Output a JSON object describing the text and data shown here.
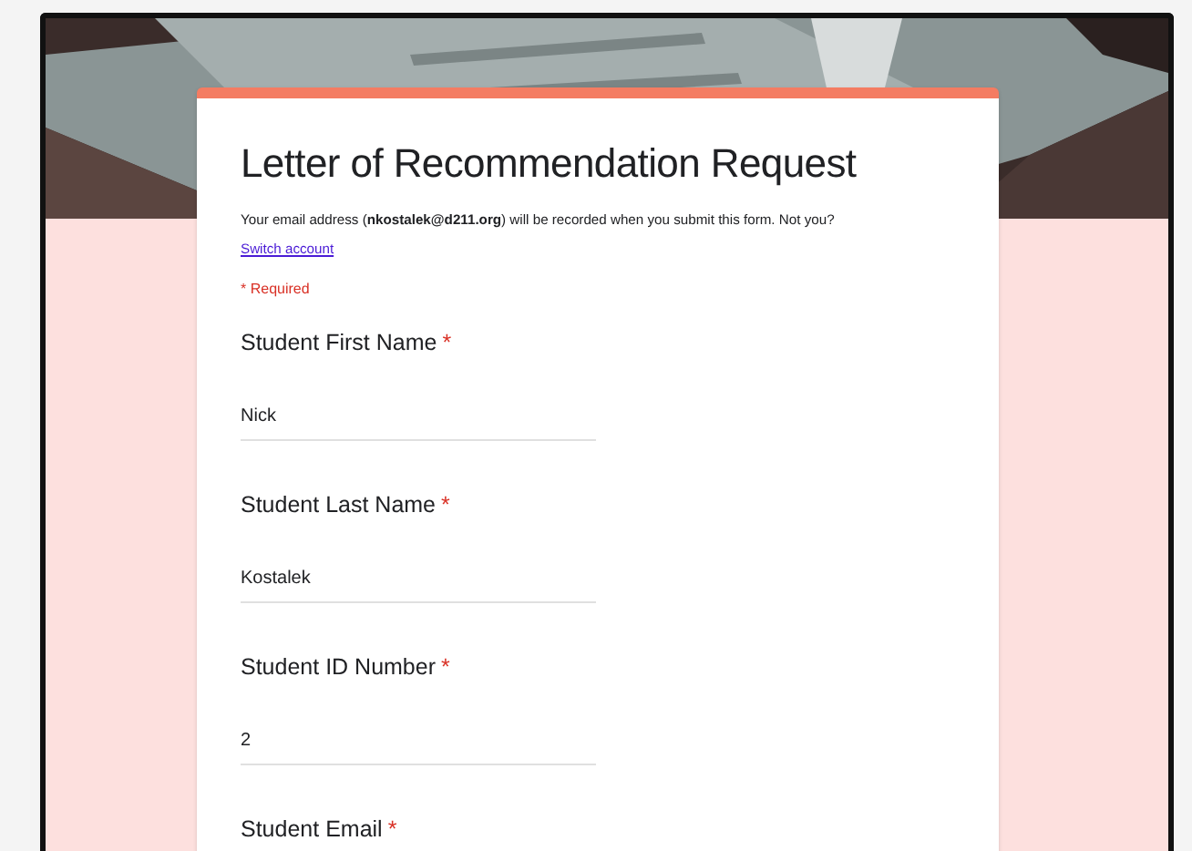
{
  "form": {
    "title": "Letter of Recommendation Request",
    "email_notice": "Your email address (**nkostalek@d211.org**) will be recorded when you submit this form. Not you?",
    "switch_account": "Switch account",
    "required_note": "* Required",
    "required_mark": "*",
    "questions": [
      {
        "label": "Student First Name",
        "required": true,
        "value": "Nick"
      },
      {
        "label": "Student Last Name",
        "required": true,
        "value": "Kostalek"
      },
      {
        "label": "Student ID Number",
        "required": true,
        "value": "2"
      },
      {
        "label": "Student Email",
        "required": true
      }
    ]
  }
}
